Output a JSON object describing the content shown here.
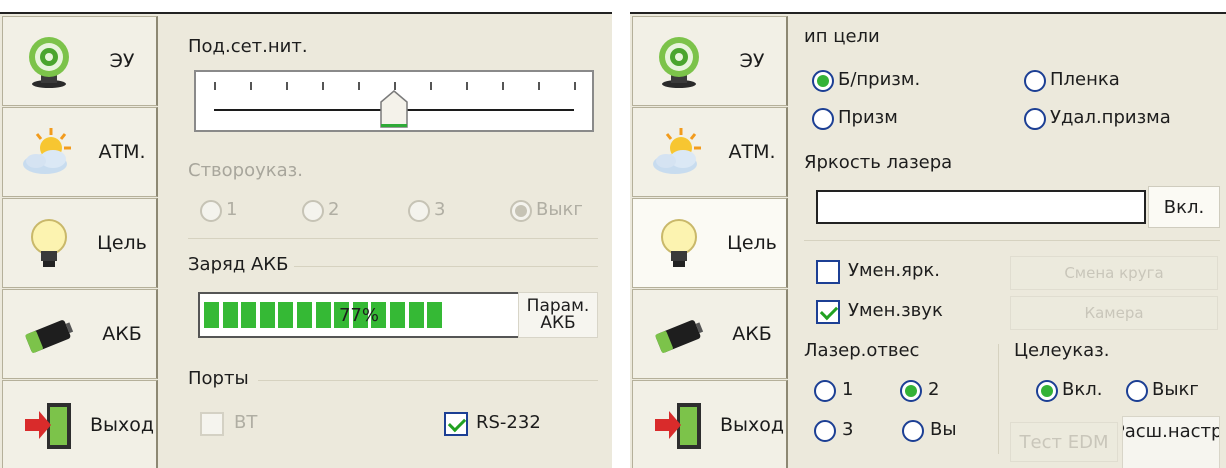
{
  "sidebar": {
    "items": [
      {
        "icon": "target-icon",
        "label": "ЭУ"
      },
      {
        "icon": "weather-icon",
        "label": "АТМ."
      },
      {
        "icon": "bulb-icon",
        "label": "Цель"
      },
      {
        "icon": "battery-icon",
        "label": "АКБ"
      },
      {
        "icon": "exit-icon",
        "label": "Выход"
      }
    ]
  },
  "left": {
    "reticle_title": "Под.сет.нит.",
    "reticle_level": 0.5,
    "plumb_title": "Створоуказ.",
    "plumb_options": [
      "1",
      "2",
      "3",
      "Выкг"
    ],
    "plumb_selected": "Выкг",
    "battery_title": "Заряд АКБ",
    "battery_value": 0.77,
    "battery_label": "77%",
    "battery_button": "Парам. АКБ",
    "ports_title": "Порты",
    "port_bt": "BT",
    "port_rs": "RS-232",
    "port_bt_checked": false,
    "port_rs_checked": true
  },
  "right": {
    "target_title": "ип цели",
    "target_options": [
      "Б/призм.",
      "Пленка",
      "Призм",
      "Удал.призма"
    ],
    "target_selected": "Б/призм.",
    "laser_title": "Яркость лазера",
    "laser_button": "Вкл.",
    "dim_brightness": "Умен.ярк.",
    "dim_brightness_checked": false,
    "dim_sound": "Умен.звук",
    "dim_sound_checked": true,
    "btn_face_change": "Смена круга",
    "btn_camera": "Камера",
    "laser_plumb_title": "Лазер.отвес",
    "laser_plumb_options": [
      "1",
      "2",
      "3",
      "Вы"
    ],
    "laser_plumb_selected": "2",
    "pointer_title": "Целеуказ.",
    "pointer_options": [
      "Вкл.",
      "Выкг"
    ],
    "pointer_selected": "Вкл.",
    "btn_edm_test": "Тест EDM",
    "btn_advanced": "Расш.настр."
  },
  "colors": {
    "panel_bg": "#ece9dc",
    "radio_border": "#1c3f94",
    "radio_dot": "#34b237",
    "progress": "#35b935"
  }
}
